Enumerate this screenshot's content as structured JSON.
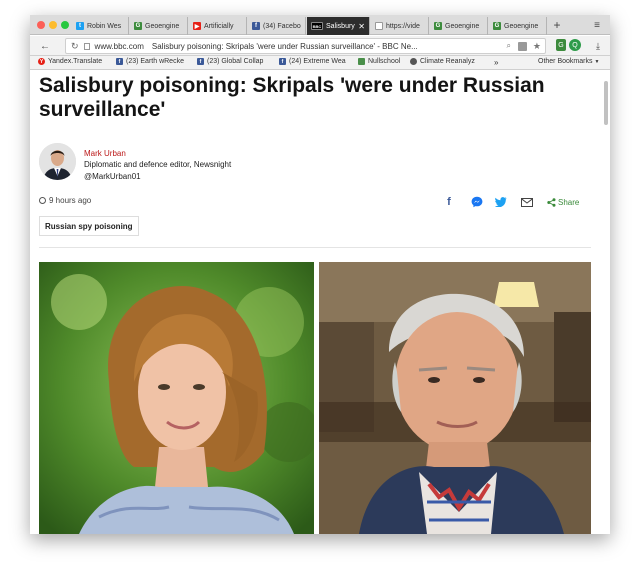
{
  "browser": {
    "tabs": [
      {
        "label": "Robin Wes",
        "favicon": "twitter-icon",
        "color": "#1da1f2"
      },
      {
        "label": "Geoengine",
        "favicon": "geoengineering-icon",
        "color": "#3d8b3d"
      },
      {
        "label": "Artificially",
        "favicon": "youtube-icon",
        "color": "#e62117"
      },
      {
        "label": "(34) Facebo",
        "favicon": "facebook-icon",
        "color": "#3b5998"
      },
      {
        "label": "Salisbury",
        "favicon": "bbc-icon",
        "color": "#000000"
      },
      {
        "label": "https://vide",
        "favicon": "page-icon",
        "color": "#9a9a9a"
      },
      {
        "label": "Geoengine",
        "favicon": "geoengineering-icon",
        "color": "#3d8b3d"
      },
      {
        "label": "Geoengine",
        "favicon": "geoengineering-icon",
        "color": "#3d8b3d"
      }
    ],
    "url_host": "www.bbc.com",
    "url_title": "Salisbury poisoning: Skripals 'were under Russian surveillance' - BBC Ne...",
    "bookmarks": [
      {
        "label": "Yandex.Translate",
        "favicon": "yandex-icon",
        "color": "#e62117"
      },
      {
        "label": "(23) Earth wRecke",
        "favicon": "facebook-icon",
        "color": "#3b5998"
      },
      {
        "label": "(23) Global Collap",
        "favicon": "facebook-icon",
        "color": "#3b5998"
      },
      {
        "label": "(24) Extreme Wea",
        "favicon": "facebook-icon",
        "color": "#3b5998"
      },
      {
        "label": "Nullschool",
        "favicon": "nullschool-icon",
        "color": "#4a8f4a"
      },
      {
        "label": "Climate Reanalyz",
        "favicon": "climate-reanalyzer-icon",
        "color": "#555555"
      }
    ],
    "other_bookmarks": "Other Bookmarks"
  },
  "article": {
    "headline": "Salisbury poisoning: Skripals 'were under Russian surveillance'",
    "author": {
      "name": "Mark Urban",
      "role": "Diplomatic and defence editor, Newsnight",
      "handle": "@MarkUrban01"
    },
    "timestamp": "9 hours ago",
    "share_label": "Share",
    "tag": "Russian spy poisoning"
  },
  "colors": {
    "author_name": "#bb1919",
    "share_green": "#3a8a3a",
    "facebook": "#3b5998",
    "messenger": "#1a77f2",
    "twitter": "#1da1f2"
  }
}
